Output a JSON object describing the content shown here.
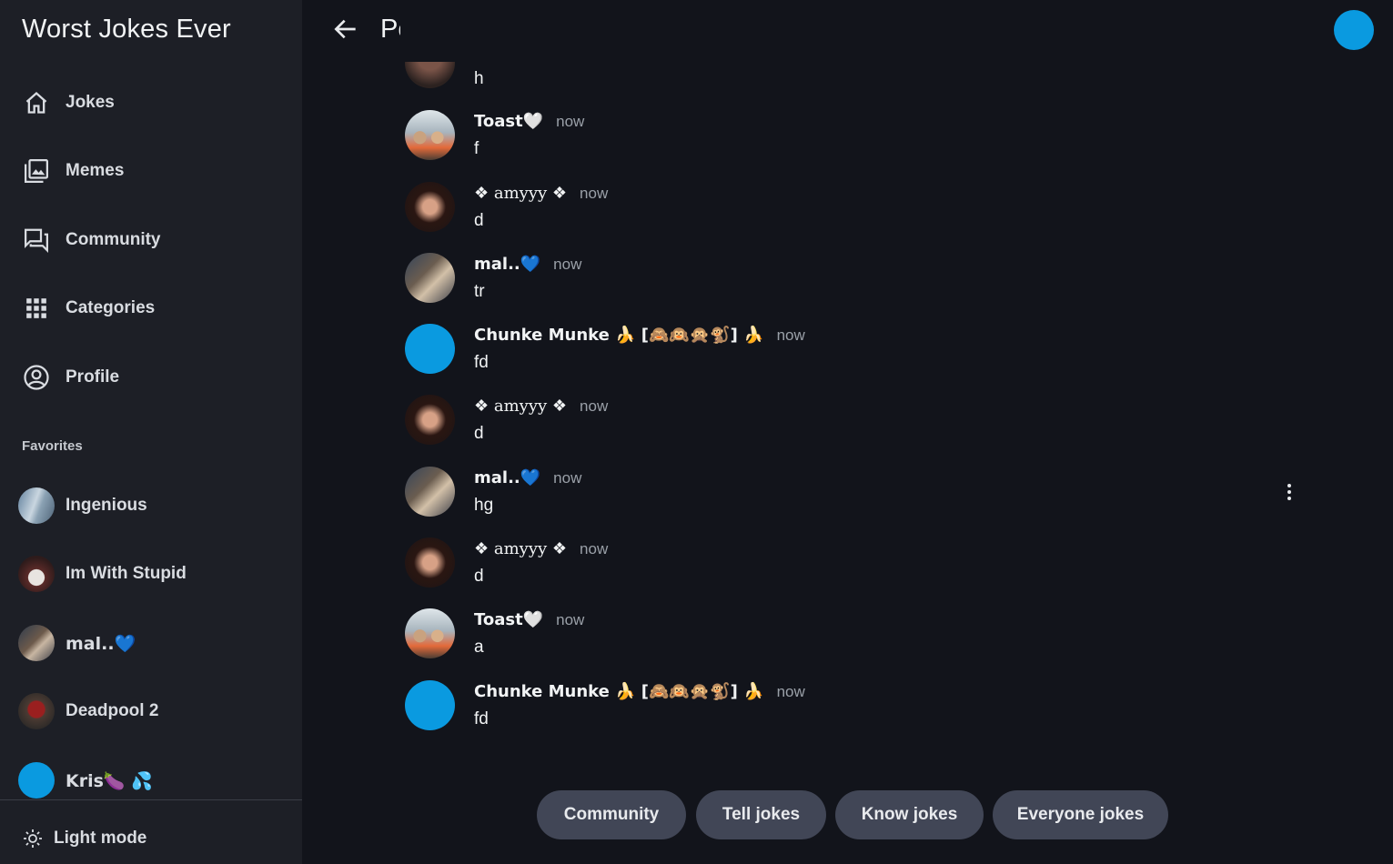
{
  "app": {
    "title": "Worst Jokes Ever"
  },
  "nav": {
    "items": [
      {
        "label": "Jokes",
        "icon": "home-icon"
      },
      {
        "label": "Memes",
        "icon": "photo-library-icon"
      },
      {
        "label": "Community",
        "icon": "forum-icon"
      },
      {
        "label": "Categories",
        "icon": "apps-grid-icon"
      },
      {
        "label": "Profile",
        "icon": "account-circle-icon"
      }
    ]
  },
  "favorites": {
    "heading": "Favorites",
    "items": [
      {
        "label": "Ingenious"
      },
      {
        "label": "Im With Stupid"
      },
      {
        "label": "mal..💙"
      },
      {
        "label": "Deadpool 2"
      },
      {
        "label": "Kris🍆 💦"
      }
    ]
  },
  "footer": {
    "light_mode_label": "Light mode"
  },
  "header": {
    "title": "Post"
  },
  "messages": {
    "partial_text": "h",
    "items": [
      {
        "name": "Toast🤍",
        "time": "now",
        "text": "f"
      },
      {
        "name": "❖ amyyy ❖",
        "time": "now",
        "text": "d"
      },
      {
        "name": "mal..💙",
        "time": "now",
        "text": "tr"
      },
      {
        "name": "Chunke Munke 🍌 [🙈🙉🙊🐒] 🍌",
        "time": "now",
        "text": "fd"
      },
      {
        "name": "❖ amyyy ❖",
        "time": "now",
        "text": "d"
      },
      {
        "name": "mal..💙",
        "time": "now",
        "text": "hg"
      },
      {
        "name": "❖ amyyy ❖",
        "time": "now",
        "text": "d"
      },
      {
        "name": "Toast🤍",
        "time": "now",
        "text": "a"
      },
      {
        "name": "Chunke Munke 🍌 [🙈🙉🙊🐒] 🍌",
        "time": "now",
        "text": "fd"
      }
    ]
  },
  "bottom_nav": {
    "community": "Community",
    "tell": "Tell jokes",
    "know": "Know jokes",
    "everyone": "Everyone jokes"
  },
  "colors": {
    "background": "#12141b",
    "sidebar": "#1d1f26",
    "accent_blue": "#0a9ae0",
    "pill": "#414656"
  }
}
